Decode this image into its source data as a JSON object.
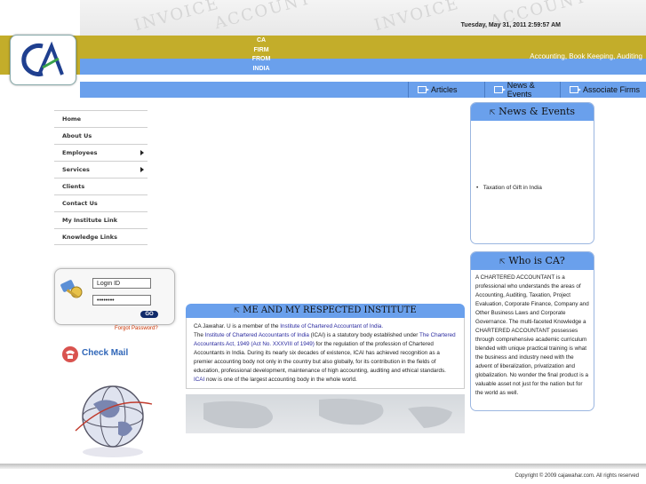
{
  "header": {
    "datetime": "Tuesday, May 31, 2011 2:59:57 AM",
    "logo_text": "CA",
    "tagline": [
      "CA",
      "FIRM",
      "FROM",
      "INDIA"
    ],
    "marquee": "Accounting, Book Keeping, Auditing",
    "band_colors": {
      "olive": "#c3ad2a",
      "blue": "#6aa0ec"
    }
  },
  "topnav": [
    {
      "label": "Articles",
      "icon": "exit-arrow-icon"
    },
    {
      "label": "News & Events",
      "icon": "exit-arrow-icon"
    },
    {
      "label": "Associate Firms",
      "icon": "exit-arrow-icon"
    }
  ],
  "sidebar": {
    "items": [
      {
        "label": "Home",
        "submenu": false
      },
      {
        "label": "About Us",
        "submenu": false
      },
      {
        "label": "Employees",
        "submenu": true
      },
      {
        "label": "Services",
        "submenu": true
      },
      {
        "label": "Clients",
        "submenu": false
      },
      {
        "label": "Contact Us",
        "submenu": false
      },
      {
        "label": "My Institute Link",
        "submenu": false
      },
      {
        "label": "Knowledge Links",
        "submenu": false
      }
    ]
  },
  "login": {
    "login_id_value": "Login ID",
    "password_value": "••••••••",
    "go_label": "GO",
    "forgot_label": "Forgot Password?",
    "checkmail_label": "Check Mail"
  },
  "institute": {
    "title": "ME AND MY RESPECTED INSTITUTE",
    "p1_a": "CA Jawahar. U is a member of the ",
    "p1_link": "Institute of Chartered Accountant of India.",
    "p2_a": "The ",
    "p2_link1": "Institute of Chartered Accountants of India",
    "p2_b": " (ICAI) is a statutory body established under ",
    "p2_link2": "The Chartered Accountants Act, 1949 (Act No. XXXVIII of 1949)",
    "p2_c": " for the regulation of the profession of Chartered Accountants in India. During its nearly six decades of existence, ICAI has achieved recognition as a premier accounting body not only in the country but also globally, for its contribution in the fields of education, professional development, maintenance of high accounting, auditing and ethical standards. ",
    "p2_link3": "ICAI",
    "p2_d": " now is one of the largest accounting body in the whole world."
  },
  "news": {
    "title": "News & Events",
    "items": [
      "Taxation of Gift in India"
    ]
  },
  "who": {
    "title": "Who is CA?",
    "text": "A CHARTERED ACCOUNTANT is a professional who understands the areas of Accounting, Auditing, Taxation, Project Evaluation, Corporate Finance, Company and Other Business Laws and Corporate Governance. The multi-faceted Knowledge a CHARTERED ACCOUNTANT possesses through comprehensive academic curriculum blended with unique practical training is what the business and industry need with the advent of liberalization, privatization and globalization. No wonder the final product is a valuable asset not just for the nation but for the world as well."
  },
  "footer": {
    "copyright": "Copyright © 2009 cajawahar.com. All rights reserved"
  }
}
